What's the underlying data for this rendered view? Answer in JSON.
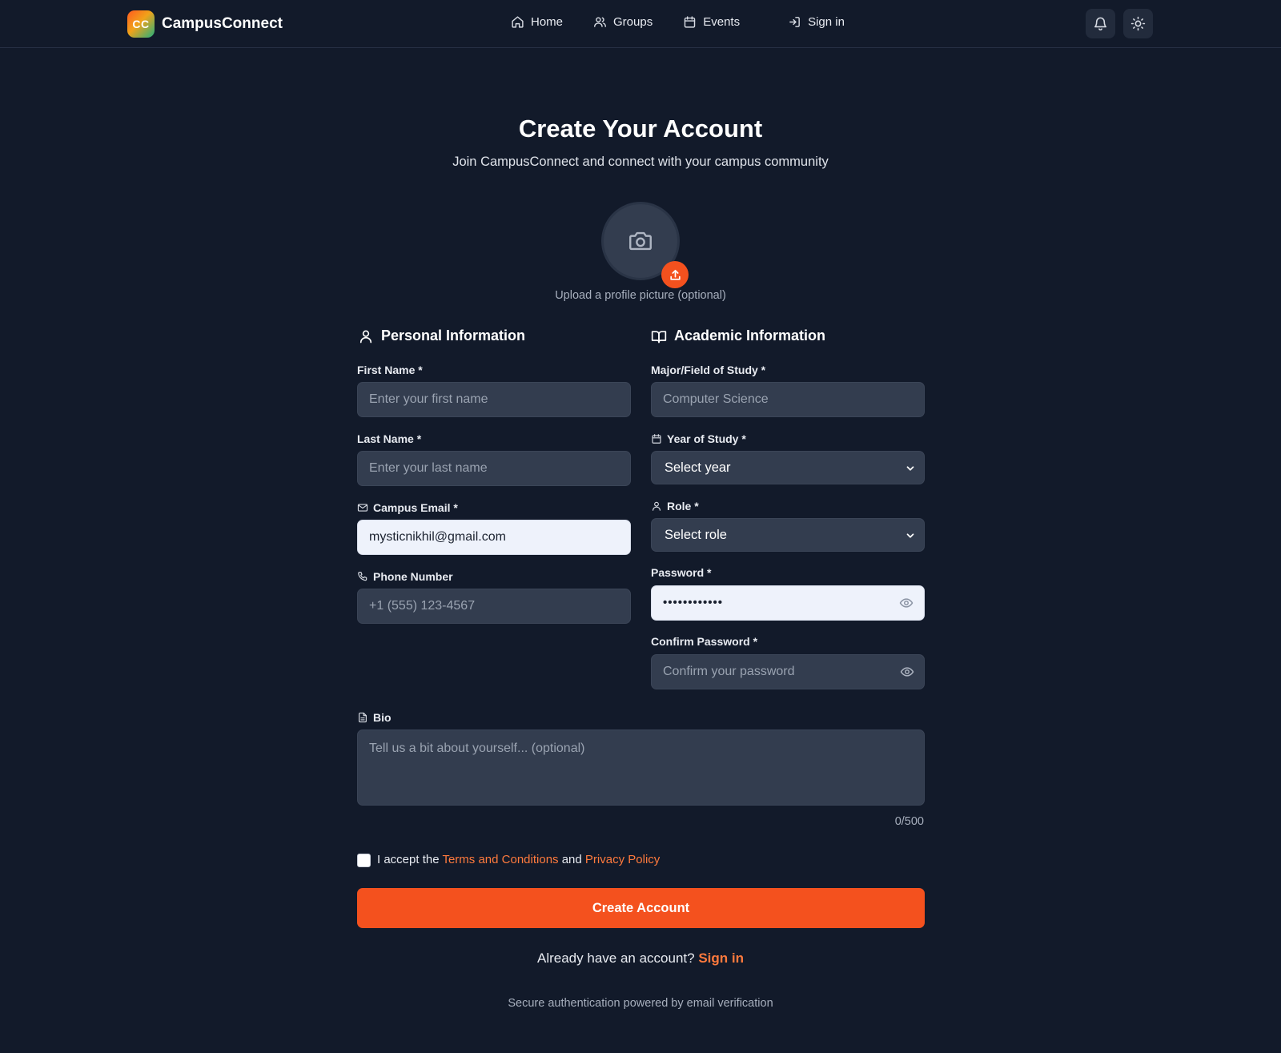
{
  "header": {
    "brand_logo_text": "CC",
    "brand_name": "CampusConnect",
    "nav": [
      {
        "label": "Home",
        "icon": "home-icon"
      },
      {
        "label": "Groups",
        "icon": "users-icon"
      },
      {
        "label": "Events",
        "icon": "calendar-icon"
      },
      {
        "label": "Sign in",
        "icon": "sign-in-icon"
      }
    ],
    "actions": [
      {
        "icon": "bell-icon"
      },
      {
        "icon": "sun-icon"
      }
    ]
  },
  "page": {
    "title": "Create Your Account",
    "subtitle": "Join CampusConnect and connect with your campus community"
  },
  "avatar": {
    "icon": "camera-icon",
    "badge_icon": "upload-icon",
    "caption": "Upload a profile picture (optional)"
  },
  "personal": {
    "heading": "Personal Information",
    "first_name": {
      "label": "First Name *",
      "placeholder": "Enter your first name",
      "value": ""
    },
    "last_name": {
      "label": "Last Name *",
      "placeholder": "Enter your last name",
      "value": ""
    },
    "email": {
      "label": "Campus Email *",
      "value": "mysticnikhil@gmail.com"
    },
    "phone": {
      "label": "Phone Number",
      "placeholder": "+1 (555) 123-4567",
      "value": ""
    }
  },
  "academic": {
    "heading": "Academic Information",
    "major": {
      "label": "Major/Field of Study *",
      "placeholder": "Computer Science",
      "value": ""
    },
    "year": {
      "label": "Year of Study *",
      "selected": "Select year"
    },
    "role": {
      "label": "Role *",
      "selected": "Select role"
    },
    "password": {
      "label": "Password *",
      "masked_value": "••••••••••••"
    },
    "confirm_password": {
      "label": "Confirm Password *",
      "placeholder": "Confirm your password",
      "value": ""
    }
  },
  "bio": {
    "label": "Bio",
    "placeholder": "Tell us a bit about yourself... (optional)",
    "counter": "0/500"
  },
  "terms": {
    "checked": false,
    "prefix": "I accept the",
    "terms_link": "Terms and Conditions",
    "middle": "and",
    "privacy_link": "Privacy Policy"
  },
  "submit_label": "Create Account",
  "signin_prompt": {
    "text": "Already have an account?",
    "link": "Sign in"
  },
  "footnote": "Secure authentication powered by email verification",
  "colors": {
    "background": "#121a2a",
    "accent": "#f4511e",
    "field": "#333d4f",
    "link": "#ff7a3d"
  }
}
